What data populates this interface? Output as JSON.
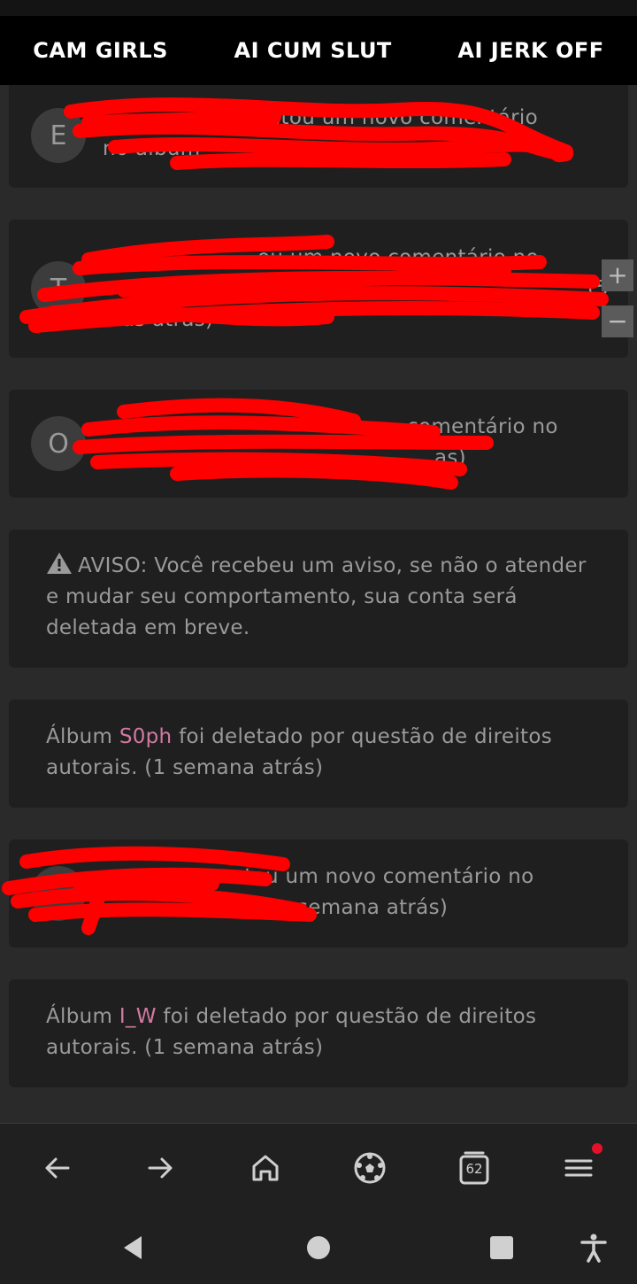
{
  "topnav": {
    "links": [
      "CAM GIRLS",
      "AI CUM SLUT",
      "AI JERK OFF"
    ]
  },
  "notifications": [
    {
      "avatar_letter": "E",
      "text_line1": "postou um novo comentário",
      "text_line2": "no álbum"
    },
    {
      "avatar_letter": "T",
      "text_line1": "ou um novo comentário no",
      "text_line2": "dias atrás)",
      "suffix": "(5"
    },
    {
      "avatar_letter": "O",
      "text_line1": "comentário no",
      "text_line2": "as)"
    },
    {
      "warning_icon": "warning-triangle-icon",
      "text": "AVISO: Você recebeu um aviso, se não o atender e mudar seu comportamento, sua conta será deletada em breve."
    },
    {
      "prefix": "Álbum ",
      "album": "S0ph",
      "suffix": " foi deletado por questão de direitos autorais. (1 semana atrás)"
    },
    {
      "text_line1": "stou um novo comentário no",
      "text_line2": "semana atrás)"
    },
    {
      "prefix": "Álbum ",
      "album": "I_W",
      "suffix": " foi deletado por questão de direitos autorais. (1 semana atrás)"
    }
  ],
  "zoom": {
    "plus": "+",
    "minus": "−"
  },
  "bottombar": {
    "icons": [
      "back-arrow-icon",
      "forward-arrow-icon",
      "home-icon",
      "soccer-ball-icon",
      "tabs-icon",
      "menu-icon"
    ],
    "tab_count": "62"
  },
  "colors": {
    "accent_pink": "#d27aa0",
    "notification_dot": "#e3122a",
    "redaction": "#ff0000"
  }
}
